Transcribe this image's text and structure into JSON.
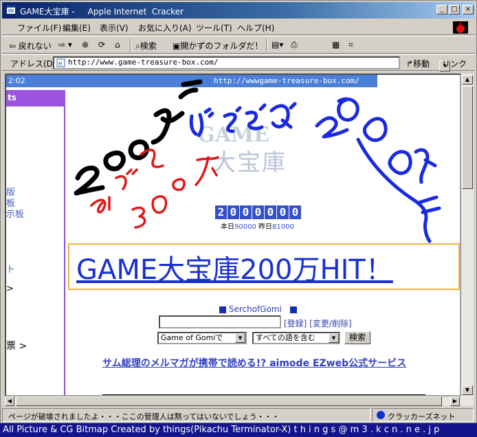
{
  "window": {
    "title": "GAME大宝庫 -     Apple Internet  Cracker"
  },
  "menu": [
    "ファイル(F)",
    "編集(E)",
    "表示(V)",
    "お気に入り(A)",
    "ツール(T)",
    "ヘルプ(H)"
  ],
  "toolbar": {
    "back": "⇦ 戻れない",
    "fwd": "⇨ ▾",
    "search": "検索",
    "folder": "開かずのフォルダだ！"
  },
  "address": {
    "label": "アドレス(D)",
    "url": "http://www.game-treasure-box.com/",
    "go": "移動",
    "links": "リンク"
  },
  "page": {
    "clock": "2:02",
    "url_banner": "http://wwwgame-treasure-box.com/",
    "left_head": "ts",
    "left_links": [
      "版",
      "板",
      "示板",
      "ト",
      ">"
    ],
    "logo_game": "GAME",
    "logo_kanji": "大宝庫",
    "counter": [
      "2",
      "0",
      "0",
      "0",
      "0",
      "0",
      "0"
    ],
    "counter_today_label": "本日",
    "counter_today": "90000",
    "counter_yesterday_label": "昨日",
    "counter_yesterday": "81000",
    "hit_text": "GAME大宝庫200万HIT！",
    "serch_label": "SerchofGomi",
    "register_link": "[登録]",
    "edit_link": "[変更/削除]",
    "select_scope": "Game of Gomiで",
    "select_mode": "すべての語を含む",
    "search_button": "検索",
    "vote": "票 >",
    "sam_link": "サム総理のメルマガが携帯で読める!? aimode EZweb公式サービス",
    "scribbles": [
      "200万",
      "めざせ300万",
      "げぇむ",
      "200万"
    ]
  },
  "status": {
    "text": "ページが破壊されましたよ・・・ここの管理人は黙ってはいないでしょう・・・",
    "zone": "クラッカーズネット"
  },
  "credit": "All Picture & CG Bitmap Created by things(Pikachu Terminator-X) t h i n g s @ m 3 . k c n . n e . j p",
  "colors": {
    "title_start": "#0a246a",
    "banner": "#4b7fd8",
    "left_head": "#9c54e0",
    "hit_text": "#1830d0",
    "counter": "#3550c8",
    "credit_bg": "#14148c"
  }
}
